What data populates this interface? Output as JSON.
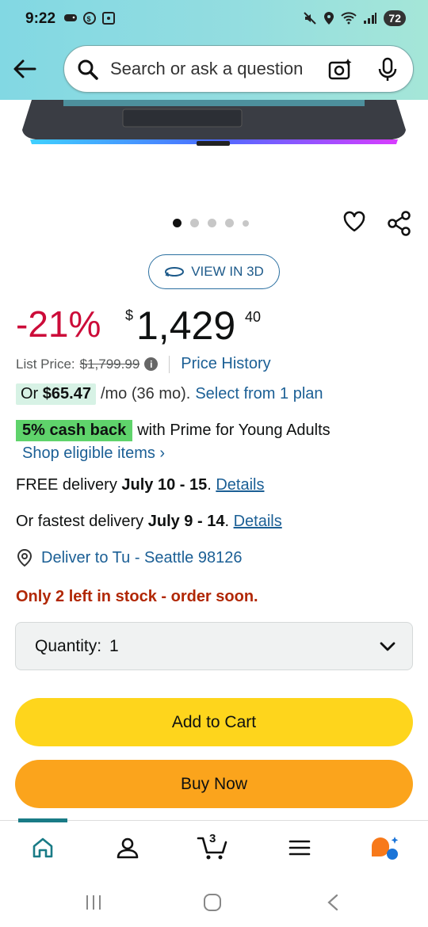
{
  "status_bar": {
    "time": "9:22",
    "battery": "72"
  },
  "search": {
    "placeholder": "Search or ask a question"
  },
  "gallery": {
    "dot_count": 5,
    "active_index": 0
  },
  "view_3d": {
    "label": "VIEW IN 3D"
  },
  "price": {
    "discount": "-21%",
    "currency": "$",
    "whole": "1,429",
    "fraction": "40",
    "list_label": "List Price:",
    "list_value": "$1,799.99",
    "price_history": "Price History"
  },
  "monthly": {
    "prefix": "Or",
    "amount": "$65.47",
    "term": "/mo (36 mo).",
    "plan_link": "Select from 1 plan"
  },
  "cashback": {
    "badge": "5% cash back",
    "text": "with Prime for Young Adults",
    "shop_link": "Shop eligible items ›"
  },
  "delivery": {
    "free_prefix": "FREE delivery",
    "free_dates": "July 10 - 15",
    "details": "Details",
    "fast_prefix": "Or fastest delivery",
    "fast_dates": "July 9 - 14",
    "location": "Deliver to Tu - Seattle 98126"
  },
  "stock": {
    "message": "Only 2 left in stock - order soon."
  },
  "quantity": {
    "label": "Quantity:",
    "value": "1"
  },
  "buttons": {
    "add_to_cart": "Add to Cart",
    "buy_now": "Buy Now"
  },
  "bottom_nav": {
    "cart_count": "3"
  },
  "colors": {
    "accent": "#197b86",
    "discount": "#cc0c39",
    "link": "#1b5f95",
    "add_to_cart": "#fed51c",
    "buy_now": "#fba41c",
    "stock": "#b12704"
  }
}
